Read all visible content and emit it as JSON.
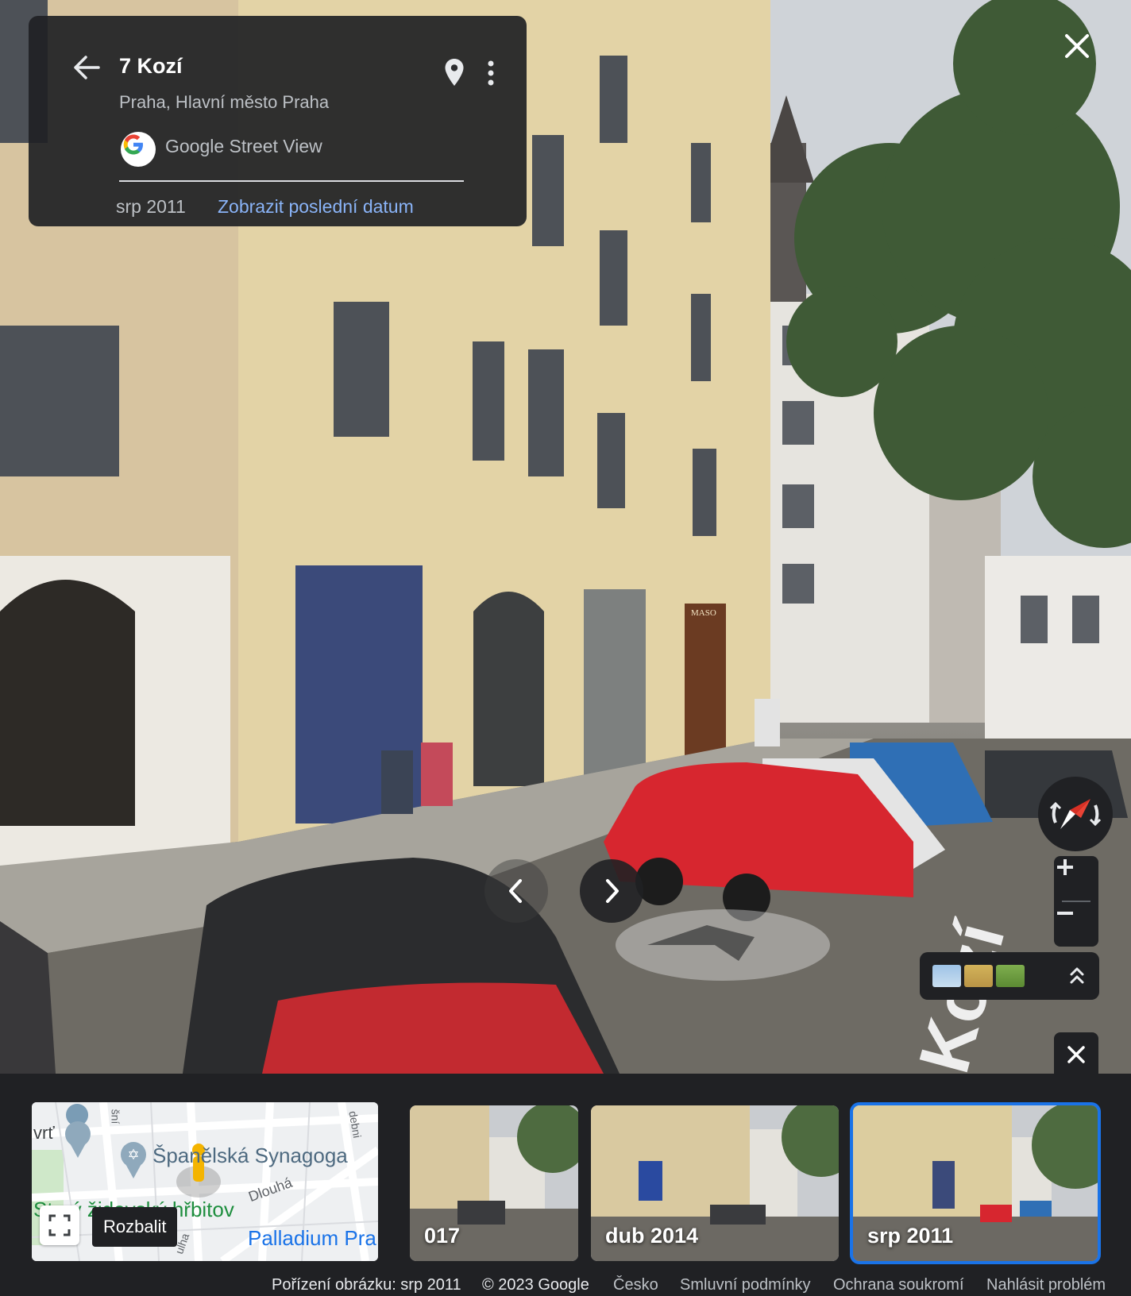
{
  "info_card": {
    "title": "7 Kozí",
    "subtitle": "Praha, Hlavní město Praha",
    "source": "Google Street View",
    "date": "srp 2011",
    "latest_link": "Zobrazit poslední datum"
  },
  "minimap": {
    "label_synagogue": "Španělská Synagoga",
    "label_cemetery": "Starý židovský hřbitov",
    "label_palladium": "Palladium Pra",
    "label_dlouha": "Dlouhá",
    "label_vrt": "vrť",
    "label_sni": "šní",
    "label_debni": "debni",
    "label_ulha": "ulha",
    "tooltip": "Rozbalit"
  },
  "thumbnails": [
    {
      "label": "017"
    },
    {
      "label": "dub 2014"
    },
    {
      "label": "srp 2011",
      "selected": true
    }
  ],
  "footer": {
    "capture": "Pořízení obrázku: srp 2011",
    "copyright": "© 2023 Google",
    "country": "Česko",
    "terms": "Smluvní podmínky",
    "privacy": "Ochrana soukromí",
    "report": "Nahlásit problém"
  },
  "scene": {
    "shop_sign": "MASO"
  },
  "icons": [
    "back-arrow-icon",
    "map-pin-icon",
    "more-vert-icon",
    "close-icon",
    "compass-icon",
    "zoom-in-icon",
    "zoom-out-icon",
    "layers-expand-icon",
    "expand-icon",
    "chevron-left-icon",
    "chevron-right-icon",
    "google-logo-icon"
  ]
}
